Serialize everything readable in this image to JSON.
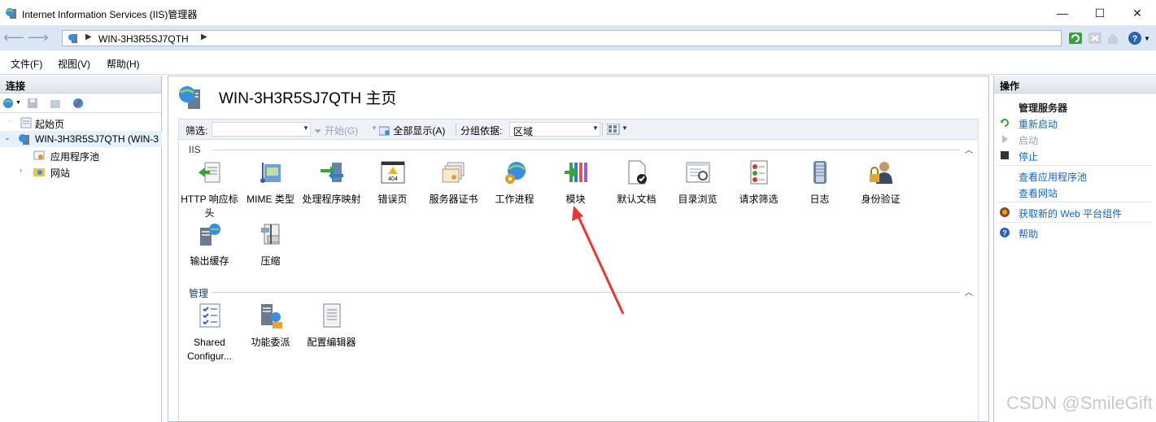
{
  "window": {
    "title": "Internet Information Services (IIS)管理器",
    "minimize": "—",
    "maximize": "☐",
    "close": "✕"
  },
  "address": {
    "crumb": "WIN-3H3R5SJ7QTH"
  },
  "menu": {
    "items": [
      "文件(F)",
      "视图(V)",
      "帮助(H)"
    ]
  },
  "connections": {
    "header": "连接",
    "tree": [
      {
        "label": "起始页",
        "level": 1
      },
      {
        "label": "WIN-3H3R5SJ7QTH (WIN-3",
        "level": 1
      },
      {
        "label": "应用程序池",
        "level": 2
      },
      {
        "label": "网站",
        "level": 2
      }
    ]
  },
  "center": {
    "title": "WIN-3H3R5SJ7QTH 主页",
    "filter": {
      "label": "筛选:",
      "start": "开始(G)",
      "show_all": "全部显示(A)",
      "group_by_label": "分组依据:",
      "group_by_value": "区域"
    },
    "groups": [
      {
        "title": "IIS",
        "features": [
          {
            "label": "HTTP 响应标头",
            "icon": "http-response-headers-icon"
          },
          {
            "label": "MIME 类型",
            "icon": "mime-types-icon"
          },
          {
            "label": "处理程序映射",
            "icon": "handler-mappings-icon"
          },
          {
            "label": "错误页",
            "icon": "error-pages-icon"
          },
          {
            "label": "服务器证书",
            "icon": "server-certificates-icon"
          },
          {
            "label": "工作进程",
            "icon": "worker-processes-icon"
          },
          {
            "label": "模块",
            "icon": "modules-icon"
          },
          {
            "label": "默认文档",
            "icon": "default-document-icon"
          },
          {
            "label": "目录浏览",
            "icon": "directory-browsing-icon"
          },
          {
            "label": "请求筛选",
            "icon": "request-filtering-icon"
          },
          {
            "label": "日志",
            "icon": "logging-icon"
          },
          {
            "label": "身份验证",
            "icon": "authentication-icon"
          },
          {
            "label": "输出缓存",
            "icon": "output-caching-icon"
          },
          {
            "label": "压缩",
            "icon": "compression-icon"
          }
        ]
      },
      {
        "title": "管理",
        "features": [
          {
            "label": "Shared Configur...",
            "icon": "shared-configuration-icon"
          },
          {
            "label": "功能委派",
            "icon": "feature-delegation-icon"
          },
          {
            "label": "配置编辑器",
            "icon": "configuration-editor-icon"
          }
        ]
      }
    ]
  },
  "actions": {
    "header": "操作",
    "manage_server": "管理服务器",
    "restart": "重新启动",
    "start": "启动",
    "stop": "停止",
    "view_app_pools": "查看应用程序池",
    "view_sites": "查看网站",
    "get_web_platform": "获取新的 Web 平台组件",
    "help": "帮助"
  },
  "watermark": "CSDN @SmileGift",
  "colors": {
    "accent": "#1565c0",
    "annotation_arrow": "#e53935"
  }
}
